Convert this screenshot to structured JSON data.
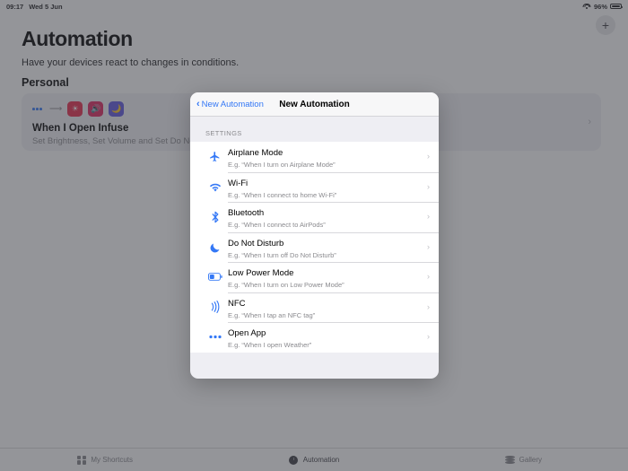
{
  "status_bar": {
    "time": "09:17",
    "date": "Wed 5 Jun",
    "wifi_icon": "wifi-icon",
    "battery_percent": "96%",
    "battery_icon": "battery-icon"
  },
  "header": {
    "title": "Automation",
    "subtitle": "Have your devices react to changes in conditions.",
    "add_button_label": "+"
  },
  "personal_section": {
    "title": "Personal",
    "automation": {
      "icons": [
        "more-dots-icon",
        "arrow-right-icon",
        "brightness-icon",
        "volume-icon",
        "moon-icon"
      ],
      "title": "When I Open Infuse",
      "subtitle": "Set Brightness, Set Volume and Set Do Not Disturb",
      "chevron": "›"
    }
  },
  "modal": {
    "back_label": "New Automation",
    "back_chevron": "‹",
    "title": "New Automation",
    "group_label": "SETTINGS",
    "rows": [
      {
        "icon": "airplane-icon",
        "title": "Airplane Mode",
        "subtitle": "E.g. “When I turn on Airplane Mode”",
        "chevron": "›"
      },
      {
        "icon": "wifi-icon",
        "title": "Wi-Fi",
        "subtitle": "E.g. “When I connect to home Wi-Fi”",
        "chevron": "›"
      },
      {
        "icon": "bluetooth-icon",
        "title": "Bluetooth",
        "subtitle": "E.g. “When I connect to AirPods”",
        "chevron": "›"
      },
      {
        "icon": "moon-icon",
        "title": "Do Not Disturb",
        "subtitle": "E.g. “When I turn off Do Not Disturb”",
        "chevron": "›"
      },
      {
        "icon": "battery-low-icon",
        "title": "Low Power Mode",
        "subtitle": "E.g. “When I turn on Low Power Mode”",
        "chevron": "›"
      },
      {
        "icon": "nfc-icon",
        "title": "NFC",
        "subtitle": "E.g. “When I tap an NFC tag”",
        "chevron": "›"
      },
      {
        "icon": "more-dots-icon",
        "title": "Open App",
        "subtitle": "E.g. “When I open Weather”",
        "chevron": "›"
      }
    ]
  },
  "tab_bar": {
    "tabs": [
      {
        "label": "My Shortcuts",
        "icon": "grid-icon",
        "active": false
      },
      {
        "label": "Automation",
        "icon": "clock-icon",
        "active": true
      },
      {
        "label": "Gallery",
        "icon": "stack-icon",
        "active": false
      }
    ]
  },
  "colors": {
    "accent_blue": "#3478f6",
    "overlay": "#7e7f84",
    "modal_body": "#eeeef3",
    "modal_header": "#f7f7f8"
  }
}
